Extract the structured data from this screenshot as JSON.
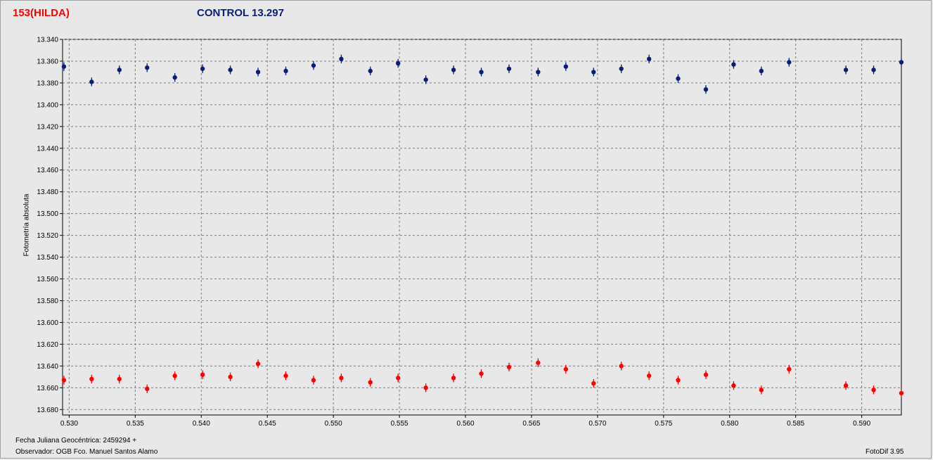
{
  "header": {
    "target_label": "153(HILDA)",
    "control_label": "CONTROL 13.297"
  },
  "footer": {
    "date_label": "Fecha Juliana Geocéntrica: 2459294 +",
    "observer_label": "Observador: OGB   Fco. Manuel Santos Alamo",
    "software_label": "FotoDif 3.95"
  },
  "colors": {
    "target": "#ff0000",
    "control": "#0a1e78",
    "plot_background": "#e8e8e8",
    "grid": "#7a7a7a"
  },
  "chart_data": {
    "type": "scatter",
    "title": "",
    "xlabel": "Fecha Juliana Geocéntrica: 2459294 +",
    "ylabel": "Fotometría absoluta",
    "xlim": [
      0.5295,
      0.593
    ],
    "ylim": [
      13.34,
      13.685
    ],
    "y_inverted": true,
    "grid": true,
    "error_bars": true,
    "x_ticks": [
      "0.530",
      "0.535",
      "0.540",
      "0.545",
      "0.550",
      "0.555",
      "0.560",
      "0.565",
      "0.570",
      "0.575",
      "0.580",
      "0.585",
      "0.590"
    ],
    "y_ticks": [
      "13.340",
      "13.360",
      "13.380",
      "13.400",
      "13.420",
      "13.440",
      "13.460",
      "13.480",
      "13.500",
      "13.520",
      "13.540",
      "13.560",
      "13.580",
      "13.600",
      "13.620",
      "13.640",
      "13.660",
      "13.680"
    ],
    "series": [
      {
        "name": "153(HILDA)",
        "color": "#ff0000",
        "error": 0.004,
        "points": [
          [
            0.5296,
            13.653
          ],
          [
            0.5317,
            13.652
          ],
          [
            0.5338,
            13.652
          ],
          [
            0.5359,
            13.661
          ],
          [
            0.538,
            13.649
          ],
          [
            0.5401,
            13.648
          ],
          [
            0.5422,
            13.65
          ],
          [
            0.5443,
            13.638
          ],
          [
            0.5464,
            13.649
          ],
          [
            0.5485,
            13.653
          ],
          [
            0.5506,
            13.651
          ],
          [
            0.5528,
            13.655
          ],
          [
            0.5549,
            13.651
          ],
          [
            0.557,
            13.66
          ],
          [
            0.5591,
            13.651
          ],
          [
            0.5612,
            13.647
          ],
          [
            0.5633,
            13.641
          ],
          [
            0.5655,
            13.637
          ],
          [
            0.5676,
            13.643
          ],
          [
            0.5697,
            13.656
          ],
          [
            0.5718,
            13.64
          ],
          [
            0.5739,
            13.649
          ],
          [
            0.5761,
            13.653
          ],
          [
            0.5782,
            13.648
          ],
          [
            0.5803,
            13.658
          ],
          [
            0.5824,
            13.662
          ],
          [
            0.5845,
            13.643
          ],
          [
            0.5888,
            13.658
          ],
          [
            0.5909,
            13.662
          ],
          [
            0.593,
            13.665
          ]
        ]
      },
      {
        "name": "CONTROL 13.297",
        "color": "#0a1e78",
        "error": 0.004,
        "points": [
          [
            0.5296,
            13.365
          ],
          [
            0.5317,
            13.379
          ],
          [
            0.5338,
            13.368
          ],
          [
            0.5359,
            13.366
          ],
          [
            0.538,
            13.375
          ],
          [
            0.5401,
            13.367
          ],
          [
            0.5422,
            13.368
          ],
          [
            0.5443,
            13.37
          ],
          [
            0.5464,
            13.369
          ],
          [
            0.5485,
            13.364
          ],
          [
            0.5506,
            13.358
          ],
          [
            0.5528,
            13.369
          ],
          [
            0.5549,
            13.362
          ],
          [
            0.557,
            13.377
          ],
          [
            0.5591,
            13.368
          ],
          [
            0.5612,
            13.37
          ],
          [
            0.5633,
            13.367
          ],
          [
            0.5655,
            13.37
          ],
          [
            0.5676,
            13.365
          ],
          [
            0.5697,
            13.37
          ],
          [
            0.5718,
            13.367
          ],
          [
            0.5739,
            13.358
          ],
          [
            0.5761,
            13.376
          ],
          [
            0.5782,
            13.386
          ],
          [
            0.5803,
            13.363
          ],
          [
            0.5824,
            13.369
          ],
          [
            0.5845,
            13.361
          ],
          [
            0.5888,
            13.368
          ],
          [
            0.5909,
            13.368
          ],
          [
            0.593,
            13.361
          ]
        ]
      }
    ]
  }
}
